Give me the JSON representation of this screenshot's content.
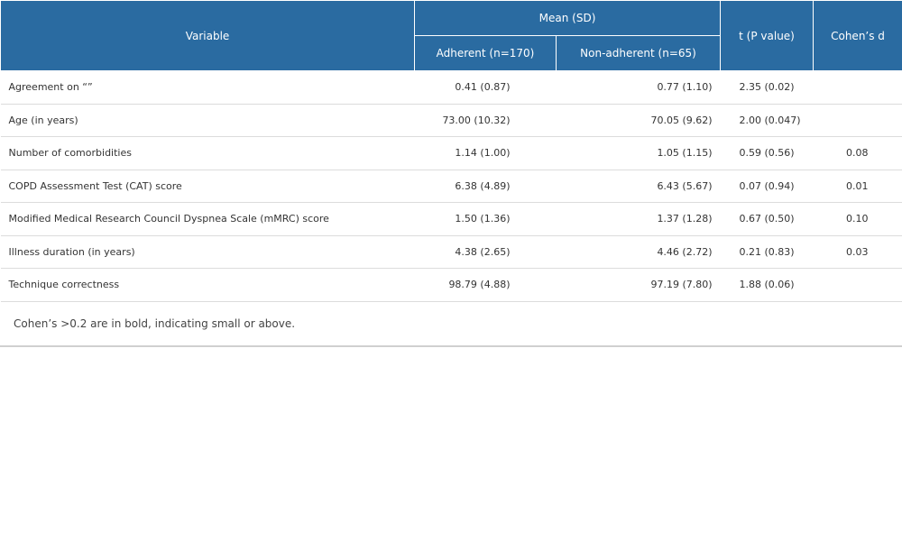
{
  "header": {
    "variable": "Variable",
    "mean_sd": "Mean (SD)",
    "adherent": "Adherent (n=170)",
    "non_adherent": "Non-adherent (n=65)",
    "t_p": "t (P value)",
    "cohens_d": "Cohen’s d"
  },
  "rows": [
    {
      "variable": "Agreement on “”",
      "adherent": "0.41 (0.87)",
      "non_adherent": "0.77 (1.10)",
      "t_p": "2.35 (0.02)",
      "cohens_d": ""
    },
    {
      "variable": "Age (in years)",
      "adherent": "73.00 (10.32)",
      "non_adherent": "70.05 (9.62)",
      "t_p": "2.00 (0.047)",
      "cohens_d": ""
    },
    {
      "variable": "Number of comorbidities",
      "adherent": "1.14 (1.00)",
      "non_adherent": "1.05 (1.15)",
      "t_p": "0.59 (0.56)",
      "cohens_d": "0.08"
    },
    {
      "variable": "COPD Assessment Test (CAT) score",
      "adherent": "6.38 (4.89)",
      "non_adherent": "6.43 (5.67)",
      "t_p": "0.07 (0.94)",
      "cohens_d": "0.01"
    },
    {
      "variable": "Modified Medical Research Council Dyspnea Scale (mMRC) score",
      "adherent": "1.50 (1.36)",
      "non_adherent": "1.37 (1.28)",
      "t_p": "0.67 (0.50)",
      "cohens_d": "0.10"
    },
    {
      "variable": "Illness duration (in years)",
      "adherent": "4.38 (2.65)",
      "non_adherent": "4.46 (2.72)",
      "t_p": "0.21 (0.83)",
      "cohens_d": "0.03"
    },
    {
      "variable": "Technique correctness",
      "adherent": "98.79 (4.88)",
      "non_adherent": "97.19 (7.80)",
      "t_p": "1.88 (0.06)",
      "cohens_d": ""
    }
  ],
  "footnote": "Cohen’s >0.2 are in bold, indicating small or above.",
  "colors": {
    "header_bg": "#2a6ba1",
    "header_text": "#ffffff",
    "row_divider": "#dcdcdc"
  }
}
